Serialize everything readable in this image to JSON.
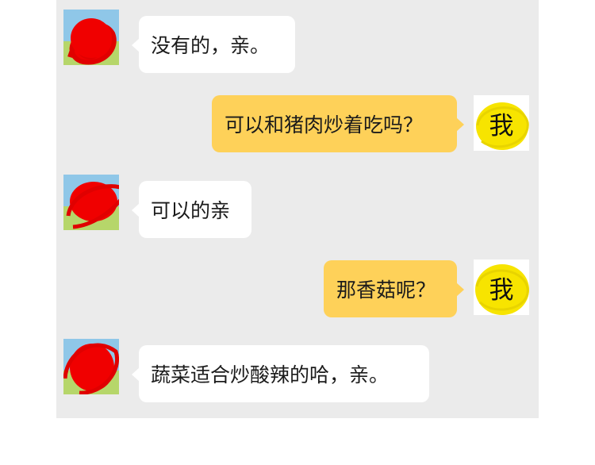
{
  "messages": [
    {
      "side": "in",
      "text": "没有的，亲。"
    },
    {
      "side": "out",
      "text": "可以和猪肉炒着吃吗？",
      "avatar_label": "我"
    },
    {
      "side": "in",
      "text": "可以的亲"
    },
    {
      "side": "out",
      "text": "那香菇呢？",
      "avatar_label": "我"
    },
    {
      "side": "in",
      "text": "蔬菜适合炒酸辣的哈，亲。"
    }
  ],
  "colors": {
    "chat_background": "#ebebeb",
    "incoming_bubble": "#ffffff",
    "outgoing_bubble": "#fed159",
    "redaction_red": "#f00000",
    "redaction_yellow": "#f7e400"
  },
  "icons": {
    "seller_avatar": "landscape-avatar-icon (scribbled out in red)",
    "user_avatar": "text-avatar (circled in yellow)"
  }
}
